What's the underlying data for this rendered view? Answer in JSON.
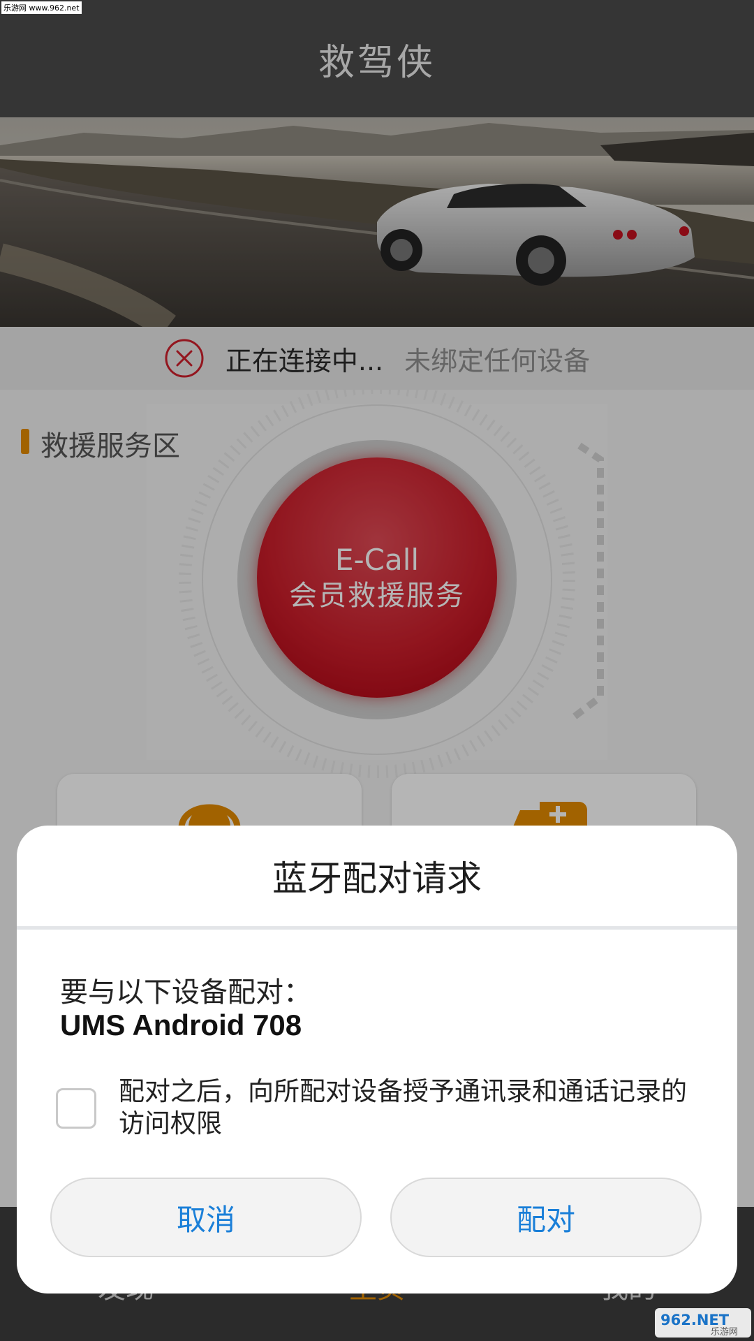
{
  "watermark_top": "乐游网 www.962.net",
  "header": {
    "title": "救驾侠"
  },
  "status": {
    "connecting": "正在连接中...",
    "unbound": "未绑定任何设备"
  },
  "section": {
    "title": "救援服务区"
  },
  "ecall": {
    "label": "E-Call",
    "sub": "会员救援服务"
  },
  "dialog": {
    "title": "蓝牙配对请求",
    "message": "要与以下设备配对：",
    "device": "UMS Android 708",
    "checkbox_text": "配对之后，向所配对设备授予通讯录和通话记录的访问权限",
    "cancel": "取消",
    "pair": "配对"
  },
  "bottom_nav": {
    "left": "发现",
    "middle": "主页",
    "right": "我的"
  },
  "watermark_bottom": {
    "logo": "962.NET",
    "sub": "乐游网"
  },
  "colors": {
    "header_bg": "#4b4b4b",
    "accent_orange": "#e38a00",
    "ecall_red": "#cc1e2b",
    "dialog_button_text": "#1a7fd8",
    "error_red": "#d0202c"
  },
  "icons": [
    "close-circle-icon",
    "headset-icon",
    "ambulance-icon",
    "checkbox-icon"
  ]
}
